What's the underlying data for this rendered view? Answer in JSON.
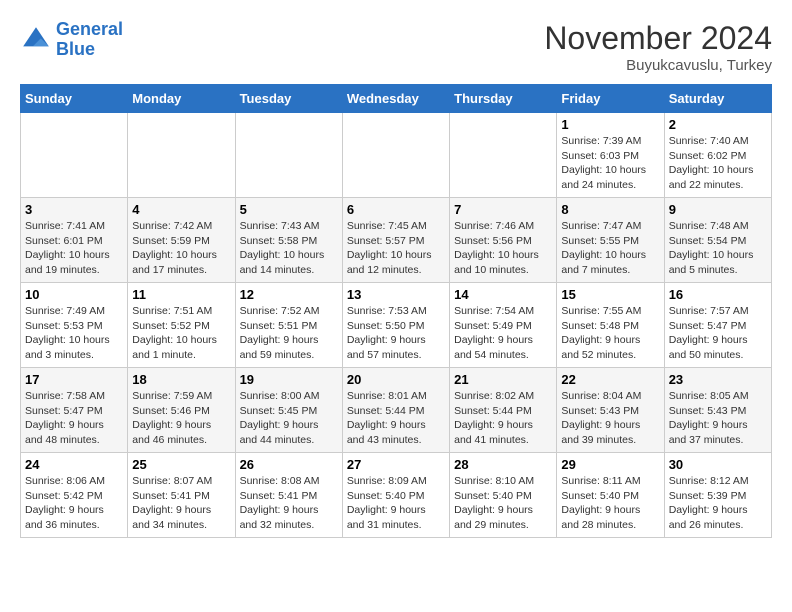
{
  "header": {
    "logo_line1": "General",
    "logo_line2": "Blue",
    "month": "November 2024",
    "location": "Buyukcavuslu, Turkey"
  },
  "weekdays": [
    "Sunday",
    "Monday",
    "Tuesday",
    "Wednesday",
    "Thursday",
    "Friday",
    "Saturday"
  ],
  "weeks": [
    [
      {
        "day": "",
        "info": ""
      },
      {
        "day": "",
        "info": ""
      },
      {
        "day": "",
        "info": ""
      },
      {
        "day": "",
        "info": ""
      },
      {
        "day": "",
        "info": ""
      },
      {
        "day": "1",
        "info": "Sunrise: 7:39 AM\nSunset: 6:03 PM\nDaylight: 10 hours\nand 24 minutes."
      },
      {
        "day": "2",
        "info": "Sunrise: 7:40 AM\nSunset: 6:02 PM\nDaylight: 10 hours\nand 22 minutes."
      }
    ],
    [
      {
        "day": "3",
        "info": "Sunrise: 7:41 AM\nSunset: 6:01 PM\nDaylight: 10 hours\nand 19 minutes."
      },
      {
        "day": "4",
        "info": "Sunrise: 7:42 AM\nSunset: 5:59 PM\nDaylight: 10 hours\nand 17 minutes."
      },
      {
        "day": "5",
        "info": "Sunrise: 7:43 AM\nSunset: 5:58 PM\nDaylight: 10 hours\nand 14 minutes."
      },
      {
        "day": "6",
        "info": "Sunrise: 7:45 AM\nSunset: 5:57 PM\nDaylight: 10 hours\nand 12 minutes."
      },
      {
        "day": "7",
        "info": "Sunrise: 7:46 AM\nSunset: 5:56 PM\nDaylight: 10 hours\nand 10 minutes."
      },
      {
        "day": "8",
        "info": "Sunrise: 7:47 AM\nSunset: 5:55 PM\nDaylight: 10 hours\nand 7 minutes."
      },
      {
        "day": "9",
        "info": "Sunrise: 7:48 AM\nSunset: 5:54 PM\nDaylight: 10 hours\nand 5 minutes."
      }
    ],
    [
      {
        "day": "10",
        "info": "Sunrise: 7:49 AM\nSunset: 5:53 PM\nDaylight: 10 hours\nand 3 minutes."
      },
      {
        "day": "11",
        "info": "Sunrise: 7:51 AM\nSunset: 5:52 PM\nDaylight: 10 hours\nand 1 minute."
      },
      {
        "day": "12",
        "info": "Sunrise: 7:52 AM\nSunset: 5:51 PM\nDaylight: 9 hours\nand 59 minutes."
      },
      {
        "day": "13",
        "info": "Sunrise: 7:53 AM\nSunset: 5:50 PM\nDaylight: 9 hours\nand 57 minutes."
      },
      {
        "day": "14",
        "info": "Sunrise: 7:54 AM\nSunset: 5:49 PM\nDaylight: 9 hours\nand 54 minutes."
      },
      {
        "day": "15",
        "info": "Sunrise: 7:55 AM\nSunset: 5:48 PM\nDaylight: 9 hours\nand 52 minutes."
      },
      {
        "day": "16",
        "info": "Sunrise: 7:57 AM\nSunset: 5:47 PM\nDaylight: 9 hours\nand 50 minutes."
      }
    ],
    [
      {
        "day": "17",
        "info": "Sunrise: 7:58 AM\nSunset: 5:47 PM\nDaylight: 9 hours\nand 48 minutes."
      },
      {
        "day": "18",
        "info": "Sunrise: 7:59 AM\nSunset: 5:46 PM\nDaylight: 9 hours\nand 46 minutes."
      },
      {
        "day": "19",
        "info": "Sunrise: 8:00 AM\nSunset: 5:45 PM\nDaylight: 9 hours\nand 44 minutes."
      },
      {
        "day": "20",
        "info": "Sunrise: 8:01 AM\nSunset: 5:44 PM\nDaylight: 9 hours\nand 43 minutes."
      },
      {
        "day": "21",
        "info": "Sunrise: 8:02 AM\nSunset: 5:44 PM\nDaylight: 9 hours\nand 41 minutes."
      },
      {
        "day": "22",
        "info": "Sunrise: 8:04 AM\nSunset: 5:43 PM\nDaylight: 9 hours\nand 39 minutes."
      },
      {
        "day": "23",
        "info": "Sunrise: 8:05 AM\nSunset: 5:43 PM\nDaylight: 9 hours\nand 37 minutes."
      }
    ],
    [
      {
        "day": "24",
        "info": "Sunrise: 8:06 AM\nSunset: 5:42 PM\nDaylight: 9 hours\nand 36 minutes."
      },
      {
        "day": "25",
        "info": "Sunrise: 8:07 AM\nSunset: 5:41 PM\nDaylight: 9 hours\nand 34 minutes."
      },
      {
        "day": "26",
        "info": "Sunrise: 8:08 AM\nSunset: 5:41 PM\nDaylight: 9 hours\nand 32 minutes."
      },
      {
        "day": "27",
        "info": "Sunrise: 8:09 AM\nSunset: 5:40 PM\nDaylight: 9 hours\nand 31 minutes."
      },
      {
        "day": "28",
        "info": "Sunrise: 8:10 AM\nSunset: 5:40 PM\nDaylight: 9 hours\nand 29 minutes."
      },
      {
        "day": "29",
        "info": "Sunrise: 8:11 AM\nSunset: 5:40 PM\nDaylight: 9 hours\nand 28 minutes."
      },
      {
        "day": "30",
        "info": "Sunrise: 8:12 AM\nSunset: 5:39 PM\nDaylight: 9 hours\nand 26 minutes."
      }
    ]
  ]
}
